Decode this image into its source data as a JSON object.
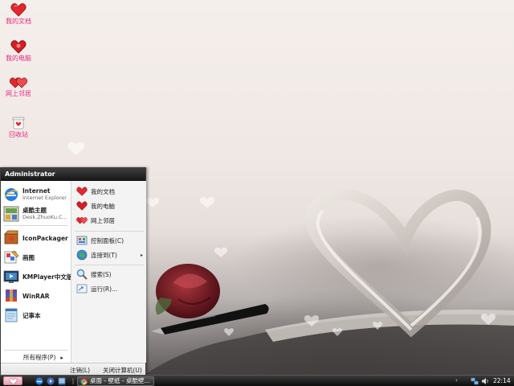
{
  "desktop": {
    "icons": [
      {
        "label": "我的文档",
        "icon": "heart-folder-icon"
      },
      {
        "label": "我的电脑",
        "icon": "heart-computer-icon"
      },
      {
        "label": "网上邻居",
        "icon": "heart-network-icon"
      },
      {
        "label": "回收站",
        "icon": "recycle-bin-icon"
      }
    ]
  },
  "start_menu": {
    "user": "Administrator",
    "pinned": [
      {
        "title": "Internet",
        "subtitle": "Internet Explorer",
        "icon": "internet-explorer-icon"
      },
      {
        "title": "桌酷主题",
        "subtitle": "Desk.ZhuoKu.C...",
        "icon": "zhuoku-theme-icon"
      }
    ],
    "recent": [
      {
        "label": "IconPackager",
        "icon": "iconpackager-icon"
      },
      {
        "label": "画图",
        "icon": "paint-icon"
      },
      {
        "label": "KMPlayer中文版",
        "icon": "kmplayer-icon"
      },
      {
        "label": "WinRAR",
        "icon": "winrar-icon"
      },
      {
        "label": "记事本",
        "icon": "notepad-icon"
      }
    ],
    "all_programs": "所有程序(P)",
    "all_programs_arrow": "▸",
    "places": [
      {
        "label": "我的文档",
        "icon": "heart-folder-icon"
      },
      {
        "label": "我的电脑",
        "icon": "heart-computer-icon"
      },
      {
        "label": "网上邻居",
        "icon": "heart-network-icon"
      }
    ],
    "system": [
      {
        "label": "控制面板(C)",
        "icon": "control-panel-icon"
      },
      {
        "label": "连接到(T)",
        "icon": "connect-to-icon",
        "submenu": "▸"
      }
    ],
    "tools": [
      {
        "label": "搜索(S)",
        "icon": "search-icon"
      },
      {
        "label": "运行(R)...",
        "icon": "run-icon"
      }
    ],
    "logoff": "注销(L)",
    "shutdown": "关闭计算机(U)"
  },
  "taskbar": {
    "task_label": "桌面 - 壁纸 - 桌酷壁...",
    "tray_arrow": "‹",
    "clock": "22:14"
  },
  "colors": {
    "desktop_label": "#e01a6e",
    "heart": "#e5262e",
    "menu_header": "#1f1f1f",
    "taskbar": "#1a1a1a"
  }
}
